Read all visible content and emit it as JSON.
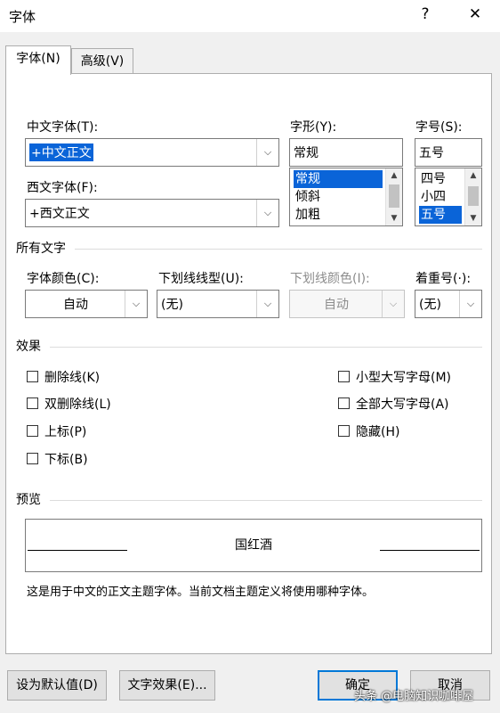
{
  "window": {
    "title": "字体",
    "help_icon": "?",
    "close_icon": "✕"
  },
  "tabs": [
    {
      "label": "字体(N)"
    },
    {
      "label": "高级(V)"
    }
  ],
  "fonts": {
    "chinese_font_label": "中文字体(T):",
    "chinese_font_value": "+中文正文",
    "western_font_label": "西文字体(F):",
    "western_font_value": "+西文正文",
    "style_label": "字形(Y):",
    "style_value": "常规",
    "style_options": [
      "常规",
      "倾斜",
      "加粗"
    ],
    "style_selected": "常规",
    "size_label": "字号(S):",
    "size_value": "五号",
    "size_options": [
      "四号",
      "小四",
      "五号"
    ],
    "size_selected": "五号"
  },
  "all_text": {
    "group_label": "所有文字",
    "font_color_label": "字体颜色(C):",
    "font_color_value": "自动",
    "underline_style_label": "下划线线型(U):",
    "underline_style_value": "(无)",
    "underline_color_label": "下划线颜色(I):",
    "underline_color_value": "自动",
    "emphasis_label": "着重号(·):",
    "emphasis_value": "(无)"
  },
  "effects": {
    "group_label": "效果",
    "left": [
      {
        "label": "删除线(K)",
        "checked": false
      },
      {
        "label": "双删除线(L)",
        "checked": false
      },
      {
        "label": "上标(P)",
        "checked": false
      },
      {
        "label": "下标(B)",
        "checked": false
      }
    ],
    "right": [
      {
        "label": "小型大写字母(M)",
        "checked": false
      },
      {
        "label": "全部大写字母(A)",
        "checked": false
      },
      {
        "label": "隐藏(H)",
        "checked": false
      }
    ]
  },
  "preview": {
    "group_label": "预览",
    "sample_text": "国红酒",
    "description": "这是用于中文的正文主题字体。当前文档主题定义将使用哪种字体。"
  },
  "buttons": {
    "set_default": "设为默认值(D)",
    "text_effects": "文字效果(E)...",
    "ok": "确定",
    "cancel": "取消"
  },
  "watermark": "头条 @电脑知识咖啡屋"
}
